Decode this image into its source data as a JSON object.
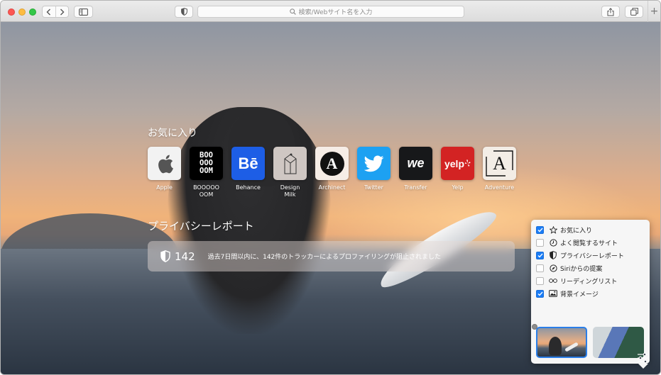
{
  "toolbar": {
    "search_placeholder": "検索/Webサイト名を入力",
    "new_tab_label": "+"
  },
  "favorites": {
    "title": "お気に入り",
    "items": [
      {
        "label": "Apple",
        "icon": "apple-logo-icon",
        "bg": "#f2f2f2"
      },
      {
        "label": "BOOOOO\nOOM",
        "icon": "booooom-logo-icon",
        "bg": "#000000",
        "tile_text": "BOO\nOOO\nOOM"
      },
      {
        "label": "Behance",
        "icon": "behance-logo-icon",
        "bg": "#1d5ee6",
        "tile_text": "Bē"
      },
      {
        "label": "Design\nMilk",
        "icon": "design-milk-logo-icon",
        "bg": "#cfc7c3"
      },
      {
        "label": "Archinect",
        "icon": "archinect-logo-icon",
        "bg": "#f6ede6",
        "tile_text": "A"
      },
      {
        "label": "Twitter",
        "icon": "twitter-bird-icon",
        "bg": "#1da1f2"
      },
      {
        "label": "Transfer",
        "icon": "wetransfer-logo-icon",
        "bg": "#17181a",
        "tile_text": "we"
      },
      {
        "label": "Yelp",
        "icon": "yelp-logo-icon",
        "bg": "#d32323",
        "tile_text": "yelp"
      },
      {
        "label": "Adventure",
        "icon": "adventure-logo-icon",
        "bg": "#f3ede6",
        "tile_text": "A"
      }
    ]
  },
  "privacy": {
    "title": "プライバシーレポート",
    "count": "142",
    "message": "過去7日間以内に、142件のトラッカーによるプロファイリングが阻止されました"
  },
  "customize": {
    "options": [
      {
        "label": "お気に入り",
        "checked": true,
        "icon": "star-icon"
      },
      {
        "label": "よく閲覧するサイト",
        "checked": false,
        "icon": "clock-icon"
      },
      {
        "label": "プライバシーレポート",
        "checked": true,
        "icon": "shield-icon"
      },
      {
        "label": "Siriからの提案",
        "checked": false,
        "icon": "compass-icon"
      },
      {
        "label": "リーディングリスト",
        "checked": false,
        "icon": "glasses-icon"
      },
      {
        "label": "背景イメージ",
        "checked": true,
        "icon": "image-icon"
      }
    ],
    "check_color": "#1a7cf5"
  }
}
